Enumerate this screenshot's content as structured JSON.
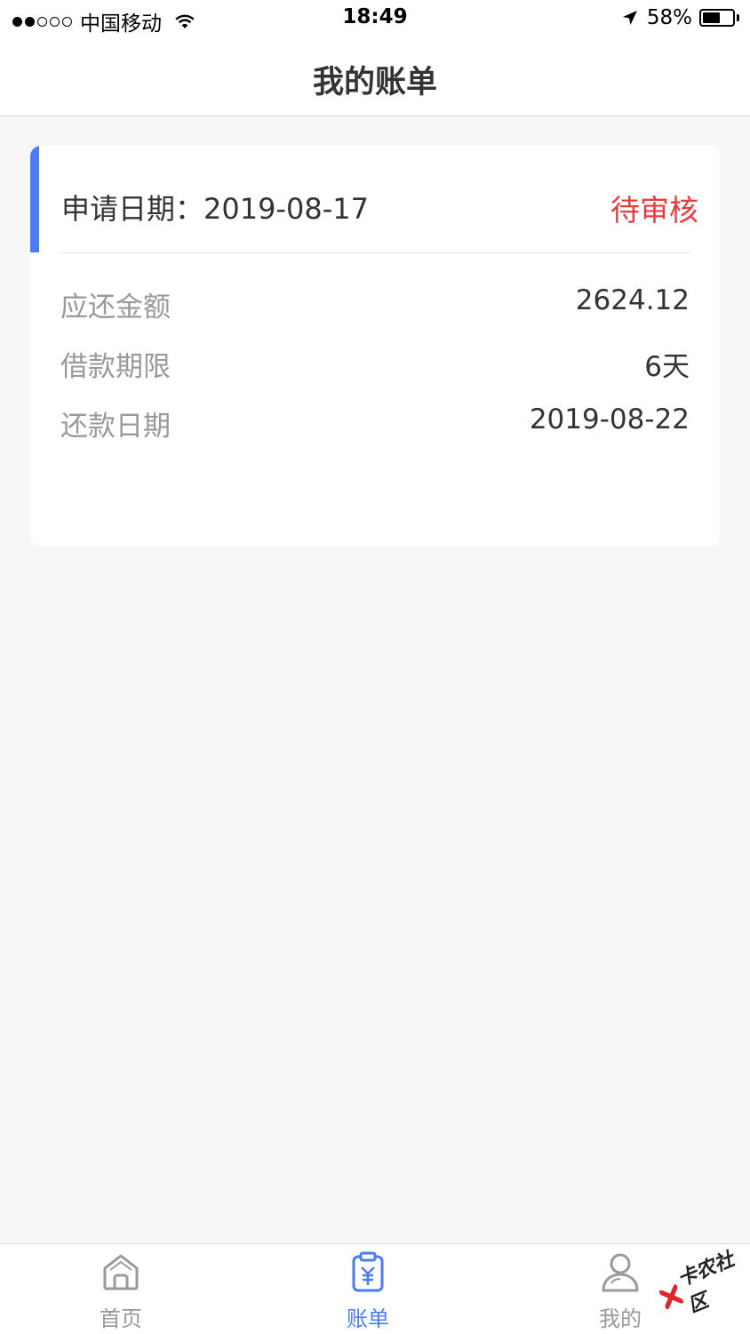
{
  "status_bar": {
    "carrier": "中国移动",
    "time": "18:49",
    "battery": "58%",
    "battery_level": 0.58,
    "signal_bars": 2
  },
  "nav": {
    "title": "我的账单"
  },
  "bill": {
    "apply_date": "申请日期：2019-08-17",
    "status": "待审核",
    "status_color": "#f0393d",
    "accent_color": "#4a7cf6",
    "rows": [
      {
        "label": "应还金额",
        "value": "2624.12"
      },
      {
        "label": "借款期限",
        "value": "6天"
      },
      {
        "label": "还款日期",
        "value": "2019-08-22"
      }
    ]
  },
  "tabs": [
    {
      "label": "首页",
      "icon": "home-icon",
      "active": false
    },
    {
      "label": "账单",
      "icon": "bill-icon",
      "active": true
    },
    {
      "label": "我的",
      "icon": "user-icon",
      "active": false
    }
  ],
  "watermark": {
    "text": "卡农社区"
  }
}
